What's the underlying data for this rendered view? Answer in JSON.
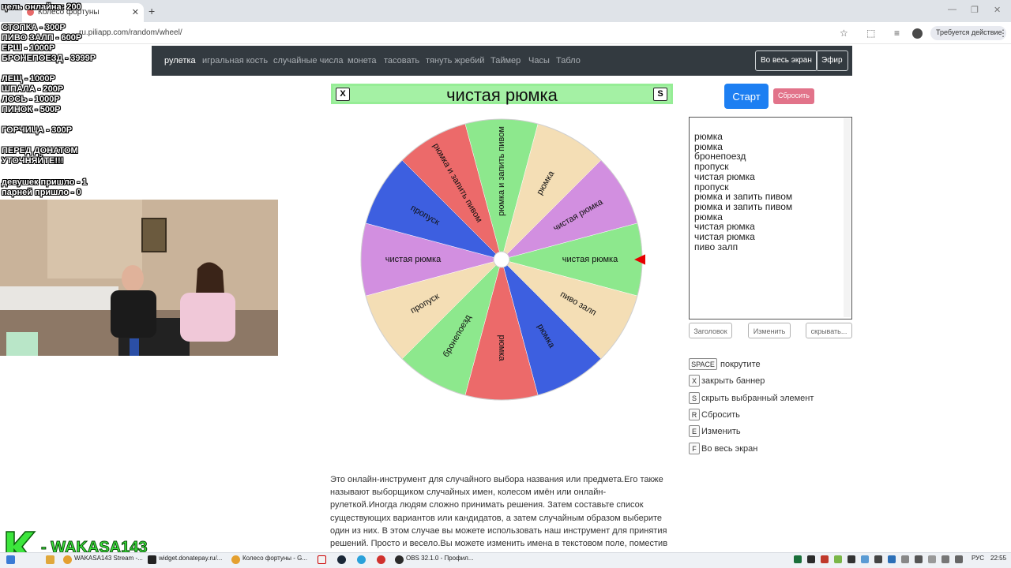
{
  "browser": {
    "tab_title": "Колесо фортуны",
    "url": "ru.piliapp.com/random/wheel/",
    "action_button": "Требуется действие"
  },
  "nav": {
    "links": [
      "рулетка",
      "игральная кость",
      "случайные числа",
      "монета",
      "тасовать",
      "тянуть жребий",
      "Таймер",
      "Часы",
      "Табло"
    ],
    "fullscreen_button": "Во весь экран",
    "broadcast_button": "Эфир"
  },
  "banner": {
    "title": "чистая рюмка",
    "close_key": "X",
    "hide_key": "S"
  },
  "wheel": {
    "segments": [
      {
        "label": "рюмка и запить пивом",
        "color": "#8de88d"
      },
      {
        "label": "рюмка",
        "color": "#f4deb5"
      },
      {
        "label": "чистая рюмка",
        "color": "#d28fe0"
      },
      {
        "label": "чистая рюмка",
        "color": "#8de88d"
      },
      {
        "label": "пиво залп",
        "color": "#f4deb5"
      },
      {
        "label": "рюмка",
        "color": "#3d5fe0"
      },
      {
        "label": "рюмка",
        "color": "#ec6a6a"
      },
      {
        "label": "бронепоезд",
        "color": "#8de88d"
      },
      {
        "label": "пропуск",
        "color": "#f4deb5"
      },
      {
        "label": "чистая рюмка",
        "color": "#d28fe0"
      },
      {
        "label": "пропуск",
        "color": "#3d5fe0"
      },
      {
        "label": "рюмка и запить пивом",
        "color": "#ec6a6a"
      }
    ],
    "pointer_color": "#e60000"
  },
  "controls": {
    "start": "Старт",
    "reset": "Сбросить"
  },
  "entries": [
    "рюмка",
    "рюмка",
    "бронепоезд",
    "пропуск",
    "чистая рюмка",
    "пропуск",
    "рюмка и запить пивом",
    "рюмка и запить пивом",
    "рюмка",
    "чистая рюмка",
    "чистая рюмка",
    "пиво залп"
  ],
  "entry_buttons": [
    "Заголовок",
    "Изменить",
    "скрывать..."
  ],
  "shortcuts": [
    {
      "key": "SPACE",
      "text": "покрутите"
    },
    {
      "key": "X",
      "text": "закрыть баннер"
    },
    {
      "key": "S",
      "text": "скрыть выбранный элемент"
    },
    {
      "key": "R",
      "text": "Сбросить"
    },
    {
      "key": "E",
      "text": "Изменить"
    },
    {
      "key": "F",
      "text": "Во весь экран"
    }
  ],
  "description": "Это онлайн-инструмент для случайного выбора названия или предмета.Его также называют выборщиком случайных имен, колесом имён или онлайн-рулеткой.Иногда людям сложно принимать решения. Затем составьте список существующих вариантов или кандидатов, а затем случайным образом выберите один из них. В этом случае вы можете использовать наш инструмент для принятия решений. Просто и весело.Вы можете изменить имена в текстовом поле, поместив одно имя в строку.Имена будут",
  "overlay": {
    "lines": [
      "цель онлайна: 200",
      "СТОПКА - 300Р",
      "ПИВО ЗАЛП - 600Р",
      "ЕРШ - 1000Р",
      "БРОНЕПОЕЗД - 3999Р",
      "ЛЕЩ - 1000Р",
      "ШПАЛА - 200Р",
      "ЛОСЬ - 1000Р",
      "ПИНОК - 500Р",
      "ГОРЧИЦА - 300Р",
      "ПЕРЕД ДОНАТОМ",
      "УТОЧНЯЙТЕ!!!",
      "девушек пришло - 1",
      "парней пришло - 0"
    ],
    "logo_text": "- WAKASA143"
  },
  "taskbar": {
    "apps": [
      "WAKASA143 Stream -...",
      "widget.donatepay.ru/...",
      "Колесо фортуны - G...",
      "OBS 32.1.0 - Профил..."
    ],
    "lang": "РУС",
    "time": "22:55"
  }
}
